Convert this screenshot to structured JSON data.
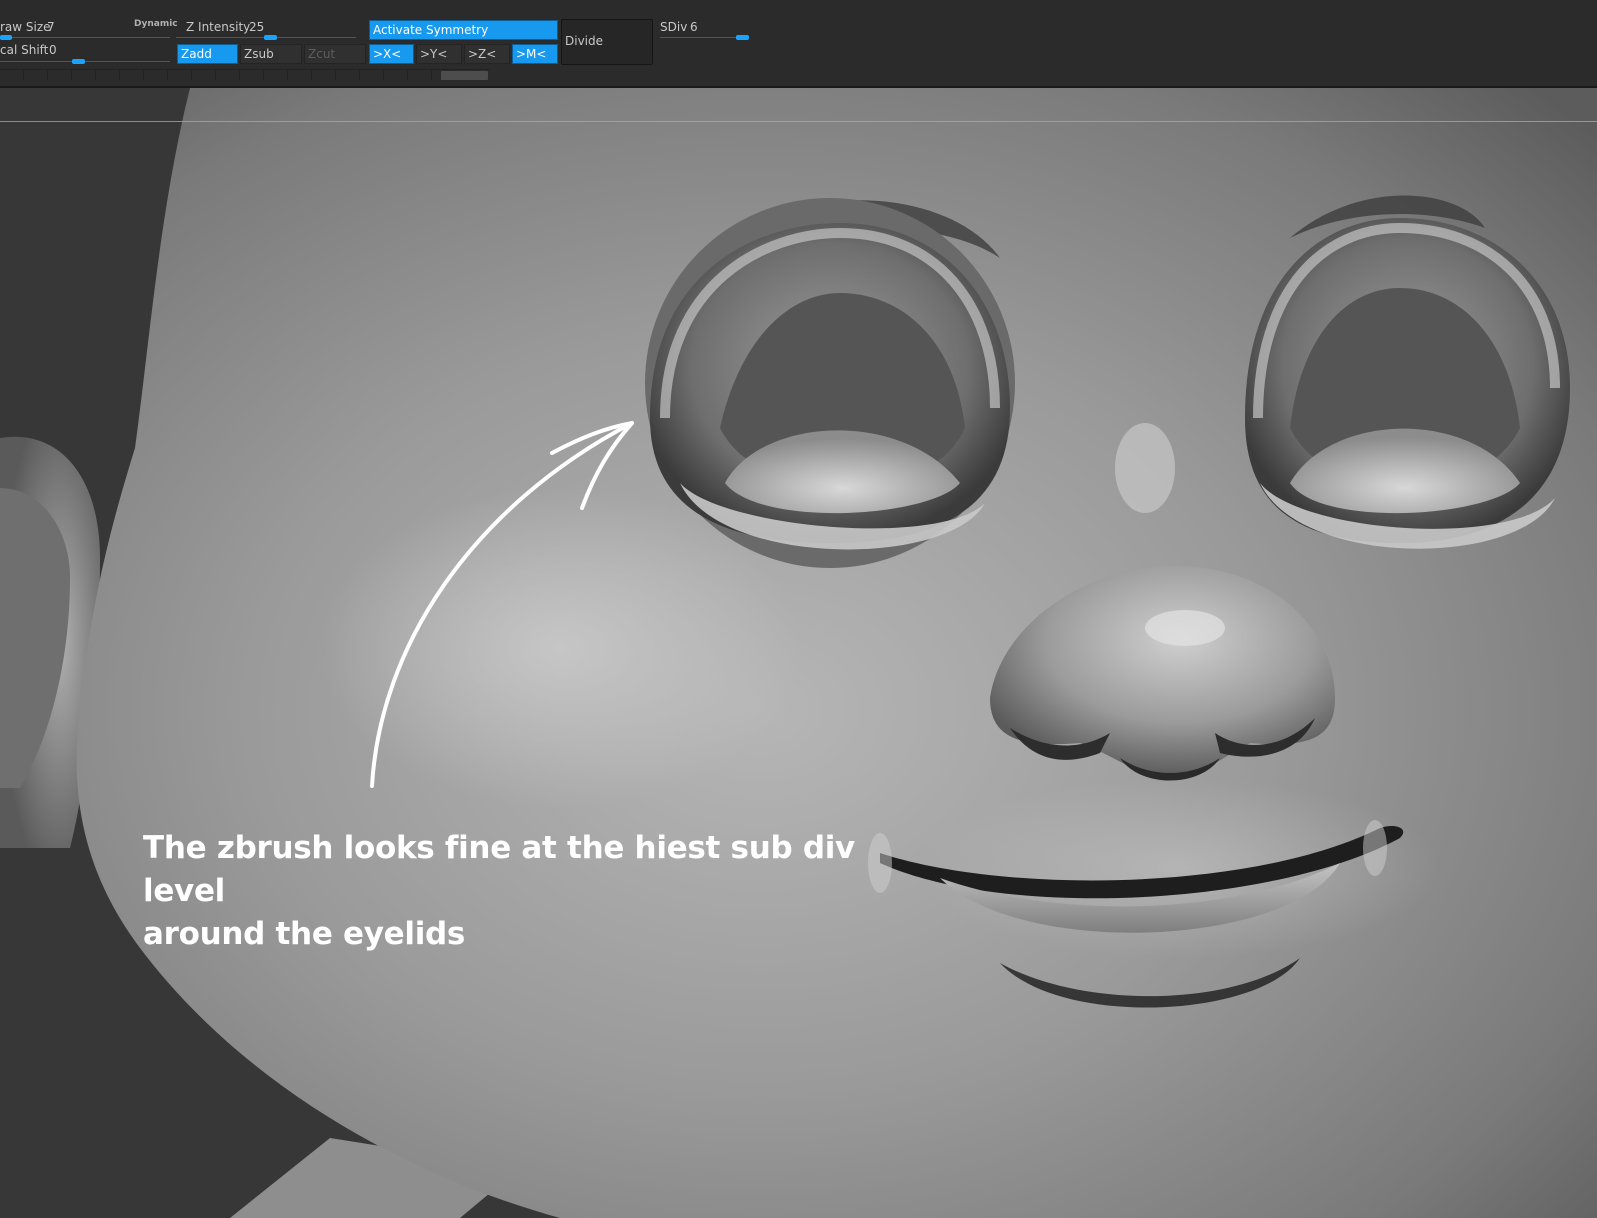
{
  "toolbar": {
    "draw_size_label": "raw Size",
    "draw_size_value": "7",
    "dynamic_label": "Dynamic",
    "focal_shift_label": "cal Shift",
    "focal_shift_value": "0",
    "z_intensity_label": "Z Intensity",
    "z_intensity_value": "25",
    "zadd_label": "Zadd",
    "zsub_label": "Zsub",
    "zcut_label": "Zcut",
    "activate_symmetry_label": "Activate Symmetry",
    "sym_x_label": ">X<",
    "sym_y_label": ">Y<",
    "sym_z_label": ">Z<",
    "sym_m_label": ">M<",
    "divide_label": "Divide",
    "sdiv_label": "SDiv",
    "sdiv_value": "6",
    "accent_color": "#1799ef"
  },
  "viewport": {
    "annotation_line1": "The zbrush looks fine at the hiest sub div level",
    "annotation_line2": "around the eyelids",
    "arrow_icon": "hand-drawn-arrow-icon"
  }
}
